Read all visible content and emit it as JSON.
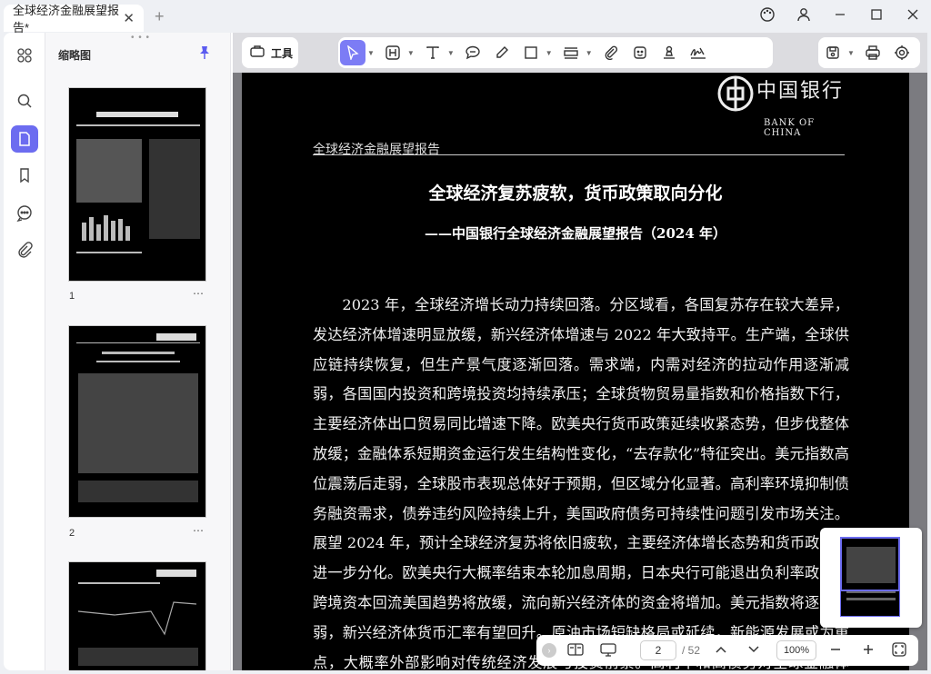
{
  "window": {
    "tab_title": "全球经济金融展望报告*",
    "close_glyph": "✕",
    "new_tab_glyph": "+"
  },
  "sidebar": {
    "header": "缩略图",
    "pages": [
      {
        "number": "1",
        "more": "⋯"
      },
      {
        "number": "2",
        "more": "⋯"
      }
    ]
  },
  "toolbar": {
    "tools_label": "工具"
  },
  "document": {
    "running_header": "全球经济金融展望报告",
    "logo_cn": "中国银行",
    "logo_en": "BANK OF CHINA",
    "title": "全球经济复苏疲软，货币政策取向分化",
    "subtitle": "——中国银行全球经济金融展望报告（2024 年）",
    "body": "2023 年，全球经济增长动力持续回落。分区域看，各国复苏存在较大差异，发达经济体增速明显放缓，新兴经济体增速与 2022 年大致持平。生产端，全球供应链持续恢复，但生产景气度逐渐回落。需求端，内需对经济的拉动作用逐渐减弱，各国国内投资和跨境投资均持续承压；全球货物贸易量指数和价格指数下行，主要经济体出口贸易同比增速下降。欧美央行货币政策延续收紧态势，但步伐整体放缓；金融体系短期资金运行发生结构性变化，“去存款化”特征突出。美元指数高位震荡后走弱，全球股市表现总体好于预期，但区域分化显著。高利率环境抑制债务融资需求，债券违约风险持续上升，美国政府债务可持续性问题引发市场关注。展望 2024 年，预计全球经济复苏将依旧疲软，主要经济体增长态势和货币政策将进一步分化。欧美央行大概率结束本轮加息周期，日本央行可能退出负利率政策，跨境资本回流美国趋势将放缓，流向新兴经济体的资金将增加。美元指数将逐步走弱，新兴经济体货币汇率有望回升。原油市场短缺格局或延续，新能源发展或为重点，大概率外部影响对传统经济发展与投资前景。高利率和高债务对全球金融体系，协助经济结构调整的影响"
  },
  "navigation": {
    "current_page": "2",
    "total_pages": "/ 52",
    "zoom": "100%"
  },
  "colors": {
    "accent": "#6c6cf0",
    "page_bg": "#000000",
    "viewer_bg": "#7b7b80"
  }
}
